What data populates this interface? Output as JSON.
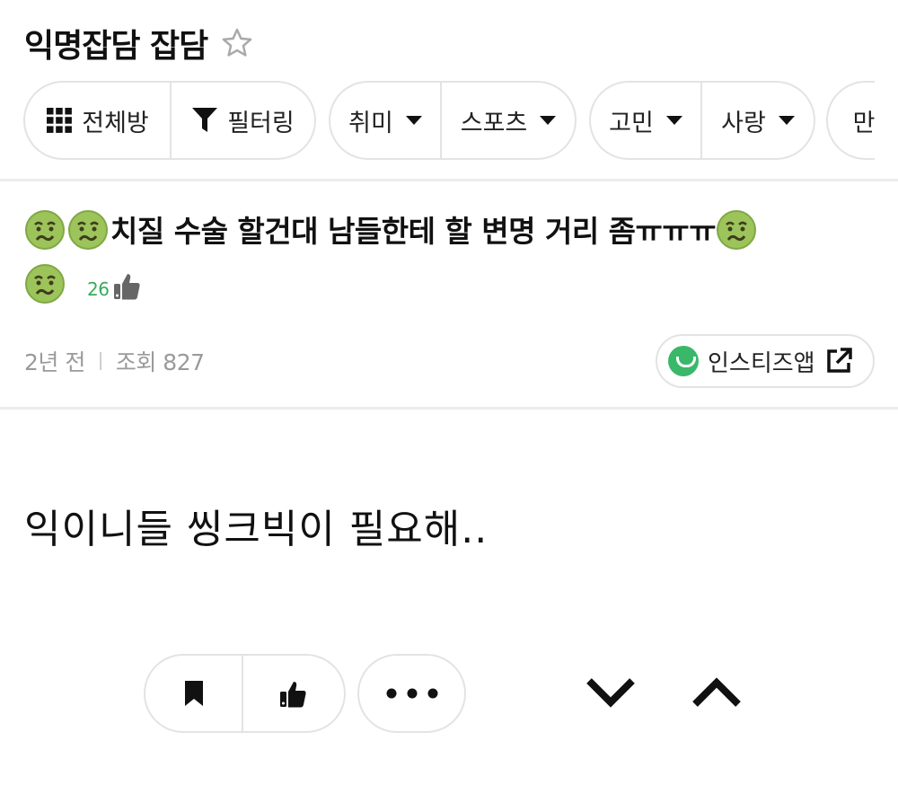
{
  "header": {
    "title": "익명잡담 잡담",
    "favorite_icon": "star-outline-icon"
  },
  "filters": [
    {
      "items": [
        {
          "icon": "grid-icon",
          "label": "전체방"
        },
        {
          "icon": "filter-icon",
          "label": "필터링"
        }
      ]
    },
    {
      "items": [
        {
          "label": "취미",
          "dropdown": true
        },
        {
          "label": "스포츠",
          "dropdown": true
        }
      ]
    },
    {
      "items": [
        {
          "label": "고민",
          "dropdown": true
        },
        {
          "label": "사랑",
          "dropdown": true
        }
      ]
    },
    {
      "items": [
        {
          "label": "만"
        }
      ]
    }
  ],
  "post": {
    "title": "치질 수술 할건대 남들한테 할 변명 거리 좀ㅠㅠㅠ",
    "emoji": "nauseated-face-emoji",
    "comment_count": "26",
    "time_ago": "2년 전",
    "views_label": "조회 827",
    "app_button_label": "인스티즈앱",
    "body": "익이니들 씽크빅이 필요해.."
  },
  "colors": {
    "accent_green": "#3aaa5c",
    "app_green": "#3ab86a",
    "border": "#e3e3e3",
    "meta_gray": "#9a9a9a"
  },
  "actions": {
    "bookmark_icon": "bookmark-icon",
    "like_icon": "thumbs-up-icon",
    "more_icon": "more-dots-icon",
    "next_icon": "chevron-down-icon",
    "prev_icon": "chevron-up-icon"
  }
}
